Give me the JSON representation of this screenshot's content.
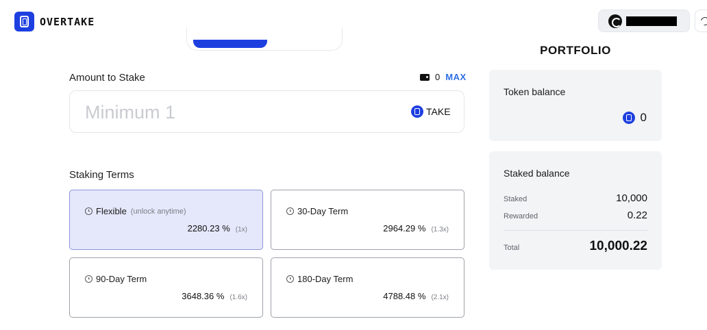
{
  "header": {
    "brand": "OVERTAKE",
    "logo_icon": "overtake-logo-icon",
    "wallet_icon": "wallet-brand-icon",
    "theme_icon": "moon-icon"
  },
  "stake": {
    "amount_label": "Amount to Stake",
    "wallet_balance": "0",
    "max_label": "MAX",
    "input_placeholder": "Minimum 1",
    "input_value": "",
    "token": "TAKE"
  },
  "terms": {
    "label": "Staking Terms",
    "items": [
      {
        "title": "Flexible",
        "subtitle": "(unlock anytime)",
        "rate": "2280.23 %",
        "multiplier": "(1x)",
        "selected": true
      },
      {
        "title": "30-Day Term",
        "subtitle": "",
        "rate": "2964.29 %",
        "multiplier": "(1.3x)",
        "selected": false
      },
      {
        "title": "90-Day Term",
        "subtitle": "",
        "rate": "3648.36 %",
        "multiplier": "(1.6x)",
        "selected": false
      },
      {
        "title": "180-Day Term",
        "subtitle": "",
        "rate": "4788.48 %",
        "multiplier": "(2.1x)",
        "selected": false
      }
    ]
  },
  "portfolio": {
    "title": "PORTFOLIO",
    "token_balance_label": "Token balance",
    "token_balance": "0",
    "staked_balance_label": "Staked balance",
    "staked_label": "Staked",
    "staked_value": "10,000",
    "rewarded_label": "Rewarded",
    "rewarded_value": "0.22",
    "total_label": "Total",
    "total_value": "10,000.22"
  },
  "colors": {
    "brand": "#1e3fe0",
    "max_link": "#2f6fe4",
    "selected_card": "#e5e8fb",
    "panel_bg": "#f3f4f6"
  }
}
